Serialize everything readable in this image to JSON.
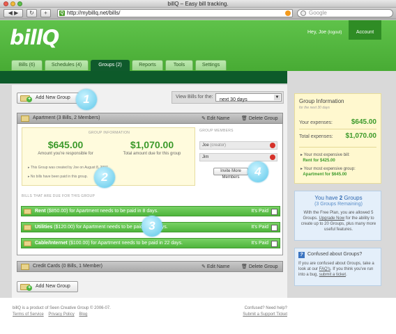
{
  "window": {
    "title": "billQ – Easy bill tracking."
  },
  "browser": {
    "url": "http://mybillq.net/bills/",
    "search_placeholder": "Google",
    "favicon_letter": "Q"
  },
  "header": {
    "logo": "billQ",
    "greeting": "Hey, Joe",
    "logout": "(logout)",
    "account": "Account"
  },
  "tabs": [
    {
      "label": "Bills (6)"
    },
    {
      "label": "Schedules (4)"
    },
    {
      "label": "Groups (2)",
      "active": true
    },
    {
      "label": "Reports"
    },
    {
      "label": "Tools"
    },
    {
      "label": "Settings"
    }
  ],
  "toolbar": {
    "add_group": "Add New Group",
    "view_label": "View Bills for the:",
    "view_value": "next 30 days"
  },
  "groups": [
    {
      "name": "Apartment (3 Bills, 2 Members)",
      "edit": "Edit Name",
      "delete": "Delete Group"
    },
    {
      "name": "Credit Cards (0 Bills, 1 Member)",
      "edit": "Edit Name",
      "delete": "Delete Group"
    }
  ],
  "group_info": {
    "caption": "GROUP INFORMATION",
    "amount_you": "$645.00",
    "amount_you_caption": "Amount you're responsible for",
    "amount_total": "$1,070.00",
    "amount_total_caption": "Total amount due for this group",
    "note1": "This Group was created by Joe on August 8, 2007.",
    "note2": "No bills have been paid in this group."
  },
  "members": {
    "caption": "GROUP MEMBERS",
    "list": [
      {
        "name": "Joe",
        "role": "(creator)"
      },
      {
        "name": "Jim",
        "role": ""
      }
    ],
    "invite": "Invite More Members"
  },
  "bills": {
    "caption": "BILLS THAT ARE DUE FOR THIS GROUP",
    "items": [
      {
        "name": "Rent",
        "text": "($850.00) for Apartment needs to be paid in 8 days.",
        "paid": "It's Paid"
      },
      {
        "name": "Utilities",
        "text": "($120.00) for Apartment needs to be paid in 15 days.",
        "paid": "It's Paid"
      },
      {
        "name": "Cable/Internet",
        "text": "($100.00) for Apartment needs to be paid in 22 days.",
        "paid": "It's Paid"
      }
    ]
  },
  "callouts": [
    "1",
    "2",
    "3",
    "4"
  ],
  "sidebar": {
    "info_title": "Group Information",
    "info_sub": "for the next 30 days",
    "your_label": "Your expenses:",
    "your_value": "$645.00",
    "total_label": "Total expenses:",
    "total_value": "$1,070.00",
    "bill_line": "Your most expensive bill:",
    "bill_value": "Rent for $425.00",
    "group_line": "Your most expensive group:",
    "group_value": "Apartment for $645.00",
    "groups_head_pre": "You have ",
    "groups_head_num": "2",
    "groups_head_post": " Groups",
    "groups_remaining": "(3 Groups Remaining)",
    "groups_text_1": "With the Free Plan, you are allowed 5 Groups.",
    "groups_link": "Upgrade Now",
    "groups_text_2": "for the ability to create up to 20 Groups, plus many more useful features.",
    "conf_head": "Confused about Groups?",
    "conf_text_1": "If you are confused about Groups, take a look at our",
    "conf_link1": "FAQ's",
    "conf_text_2": ". If you think you've run into a bug,",
    "conf_link2": "submit a ticket",
    "conf_text_3": "."
  },
  "footer": {
    "credit": "billQ is a product of Seen Creative Group © 2006-07.",
    "links": [
      "Terms of Service",
      "Privacy Policy",
      "Blog"
    ],
    "help": "Confused? Need help?",
    "support": "Submit a Support Ticket"
  },
  "colors": {
    "brand_green": "#48ab34",
    "dark_green": "#0d5a2a",
    "money_green": "#3c9a2b",
    "callout": "#5fc8ea"
  }
}
